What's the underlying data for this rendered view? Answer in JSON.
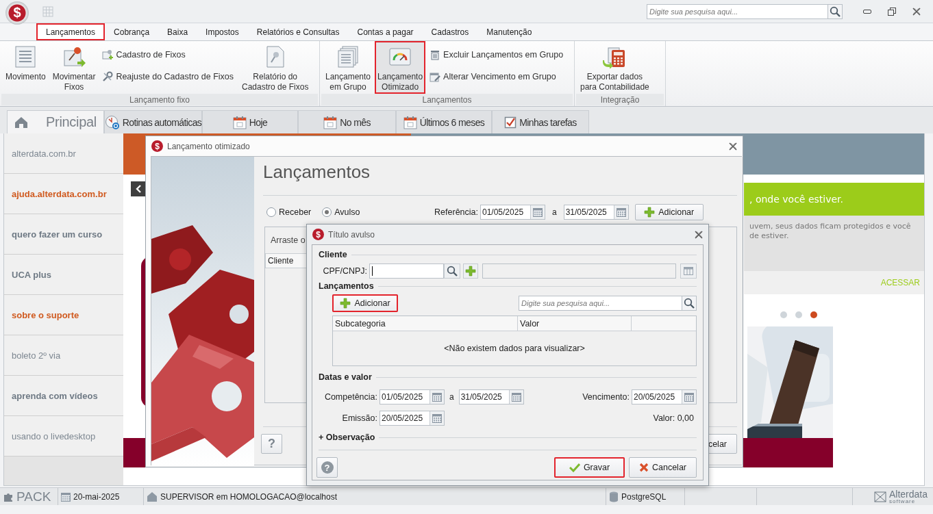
{
  "app": {
    "logo": "$",
    "search": {
      "placeholder": "Digite sua pesquisa aqui..."
    }
  },
  "menu": [
    {
      "label": "Lançamentos",
      "selected": true,
      "highlighted": true
    },
    {
      "label": "Cobrança",
      "selected": false,
      "highlighted": false
    },
    {
      "label": "Baixa",
      "selected": false,
      "highlighted": false
    },
    {
      "label": "Impostos",
      "selected": false,
      "highlighted": false
    },
    {
      "label": "Relatórios e Consultas",
      "selected": false,
      "highlighted": false
    },
    {
      "label": "Contas a pagar",
      "selected": false,
      "highlighted": false
    },
    {
      "label": "Cadastros",
      "selected": false,
      "highlighted": false
    },
    {
      "label": "Manutenção",
      "selected": false,
      "highlighted": false
    }
  ],
  "ribbon": [
    {
      "label": "Lançamento fixo",
      "items": [
        {
          "kind": "large",
          "label": "Movimento",
          "highlighted": false
        },
        {
          "kind": "large",
          "label": "Movimentar\nFixos",
          "highlighted": false
        },
        {
          "kind": "stack",
          "entries": [
            "Cadastro de Fixos",
            "Reajuste do Cadastro de Fixos"
          ]
        },
        {
          "kind": "large",
          "label": "Relatório do\nCadastro de Fixos",
          "highlighted": false
        }
      ]
    },
    {
      "label": "Lançamentos",
      "items": [
        {
          "kind": "large",
          "label": "Lançamento\nem Grupo",
          "highlighted": false
        },
        {
          "kind": "large",
          "label": "Lançamento\nOtimizado",
          "highlighted": true
        },
        {
          "kind": "stack",
          "entries": [
            "Excluir Lançamentos em Grupo",
            "Alterar Vencimento em Grupo"
          ]
        }
      ]
    },
    {
      "label": "Integração",
      "items": [
        {
          "kind": "large",
          "label": "Exportar dados\npara Contabilidade",
          "highlighted": false
        }
      ]
    }
  ],
  "page_tabs": [
    {
      "label": "Principal",
      "selected": true
    },
    {
      "label": "Rotinas automáticas",
      "selected": false
    },
    {
      "label": "Hoje",
      "selected": false
    },
    {
      "label": "No mês",
      "selected": false
    },
    {
      "label": "Últimos 6 meses",
      "selected": false
    },
    {
      "label": "Minhas tarefas",
      "selected": false
    }
  ],
  "sidebar": [
    {
      "label": "alterdata.com.br",
      "kind": "link"
    },
    {
      "label": "ajuda.alterdata.com.br",
      "kind": "highlight"
    },
    {
      "label": "quero fazer um curso",
      "kind": "bold"
    },
    {
      "label": "UCA plus",
      "kind": "bold"
    },
    {
      "label": "sobre o suporte",
      "kind": "highlight"
    },
    {
      "label": "boleto 2º via",
      "kind": "link"
    },
    {
      "label": "aprenda com vídeos",
      "kind": "bold"
    },
    {
      "label": "usando o livedesktop",
      "kind": "link"
    }
  ],
  "promo": {
    "headline": ", onde você estiver.",
    "text": "uvem, seus dados ficam protegidos e você\nde estiver.",
    "link": "ACESSAR",
    "dots": [
      {
        "selected": false
      },
      {
        "selected": false
      },
      {
        "selected": true
      }
    ]
  },
  "optimized_dialog": {
    "logo": "$",
    "title": "Lançamento otimizado",
    "heading": "Lançamentos",
    "radios": [
      {
        "label": "Receber",
        "selected": false
      },
      {
        "label": "Avulso",
        "selected": true
      }
    ],
    "reference_label": "Referência:",
    "from": "01/05/2025",
    "separator": "a",
    "to": "31/05/2025",
    "add_button": "Adicionar",
    "group_hint": "Arraste o",
    "columns": [
      "Cliente"
    ],
    "help": "?",
    "cancel_partial": "celar"
  },
  "title_dialog": {
    "logo": "$",
    "title": "Título avulso",
    "client": {
      "title": "Cliente",
      "cpf_label": "CPF/CNPJ:"
    },
    "entries": {
      "title": "Lançamentos",
      "add_button": {
        "label": "Adicionar",
        "highlighted": true
      },
      "search_placeholder": "Digite sua pesquisa aqui...",
      "columns": [
        "Subcategoria",
        "Valor"
      ],
      "empty_message": "<Não existem dados para visualizar>"
    },
    "dates": {
      "title": "Datas e valor",
      "competencia_label": "Competência:",
      "competencia_from": "01/05/2025",
      "separator": "a",
      "competencia_to": "31/05/2025",
      "vencimento_label": "Vencimento:",
      "vencimento": "20/05/2025",
      "emissao_label": "Emissão:",
      "emissao": "20/05/2025",
      "valor": "Valor: 0,00"
    },
    "observation": "+ Observação",
    "help": "?",
    "buttons": [
      {
        "kind": "save",
        "label": "Gravar",
        "highlighted": true
      },
      {
        "kind": "cancel",
        "label": "Cancelar",
        "highlighted": false
      }
    ]
  },
  "status_bar": {
    "pack": "PACK",
    "date": "20-mai-2025",
    "user": "SUPERVISOR em HOMOLOGACAO@localhost",
    "database": "PostgreSQL",
    "brand": "Alterdata",
    "brand_sub": "software"
  }
}
